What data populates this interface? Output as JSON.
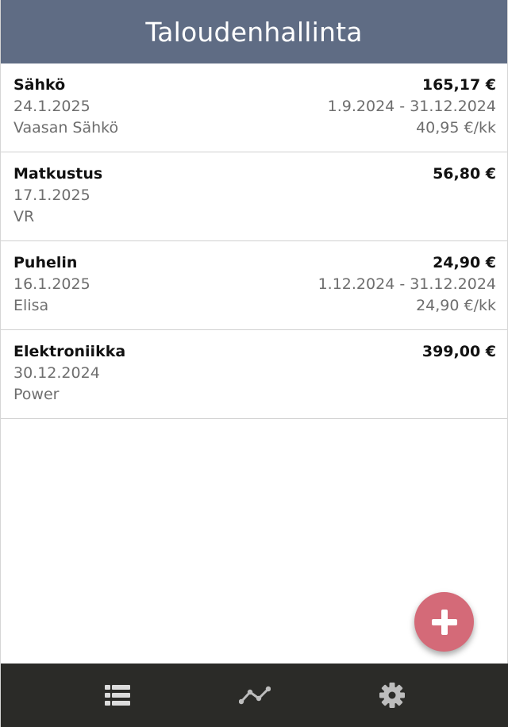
{
  "header": {
    "title": "Taloudenhallinta"
  },
  "expenses": [
    {
      "category": "Sähkö",
      "amount": "165,17 €",
      "date": "24.1.2025",
      "period": "1.9.2024 - 31.12.2024",
      "vendor": "Vaasan Sähkö",
      "monthly": "40,95 €/kk"
    },
    {
      "category": "Matkustus",
      "amount": "56,80 €",
      "date": "17.1.2025",
      "period": "",
      "vendor": "VR",
      "monthly": ""
    },
    {
      "category": "Puhelin",
      "amount": "24,90 €",
      "date": "16.1.2025",
      "period": "1.12.2024 - 31.12.2024",
      "vendor": "Elisa",
      "monthly": "24,90 €/kk"
    },
    {
      "category": "Elektroniikka",
      "amount": "399,00 €",
      "date": "30.12.2024",
      "period": "",
      "vendor": "Power",
      "monthly": ""
    }
  ],
  "fab": {
    "icon": "plus-icon"
  },
  "nav": [
    {
      "icon": "list-icon"
    },
    {
      "icon": "chart-line-icon"
    },
    {
      "icon": "gear-icon"
    }
  ],
  "colors": {
    "header_bg": "#5f6c84",
    "nav_bg": "#2b2b28",
    "fab_bg": "#d46a78",
    "muted_text": "#6e6e6e"
  }
}
